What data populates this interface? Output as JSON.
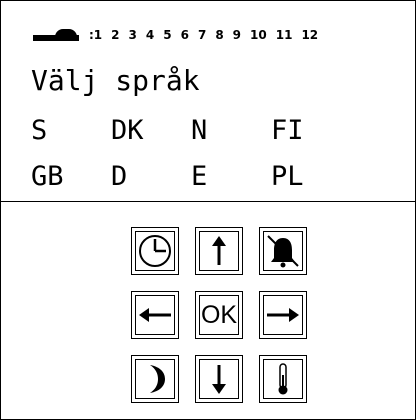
{
  "status": {
    "indicator_icon": "display-indicator-icon",
    "prefix": ":1",
    "numbers": [
      "2",
      "3",
      "4",
      "5",
      "6",
      "7",
      "8",
      "9",
      "10",
      "11",
      "12"
    ]
  },
  "display": {
    "title": "Välj språk",
    "languages_row1": [
      "S",
      "DK",
      "N",
      "FI"
    ],
    "languages_row2": [
      "GB",
      "D",
      "E",
      "PL"
    ]
  },
  "keys": {
    "clock": "clock-icon",
    "up": "arrow-up-icon",
    "alarm_off": "bell-off-icon",
    "left": "arrow-left-icon",
    "ok": "OK",
    "right": "arrow-right-icon",
    "night": "moon-icon",
    "down": "arrow-down-icon",
    "temperature": "thermometer-icon"
  }
}
